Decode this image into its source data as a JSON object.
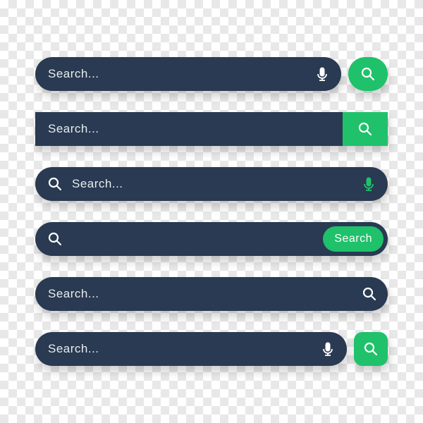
{
  "colors": {
    "bar_bg": "#293a52",
    "accent": "#1fc16b",
    "text": "#ffffff"
  },
  "rows": [
    {
      "placeholder": "Search...",
      "button_label": ""
    },
    {
      "placeholder": "Search...",
      "button_label": ""
    },
    {
      "placeholder": "Search...",
      "button_label": ""
    },
    {
      "placeholder": "",
      "button_label": "Search"
    },
    {
      "placeholder": "Search...",
      "button_label": ""
    },
    {
      "placeholder": "Search...",
      "button_label": ""
    }
  ]
}
